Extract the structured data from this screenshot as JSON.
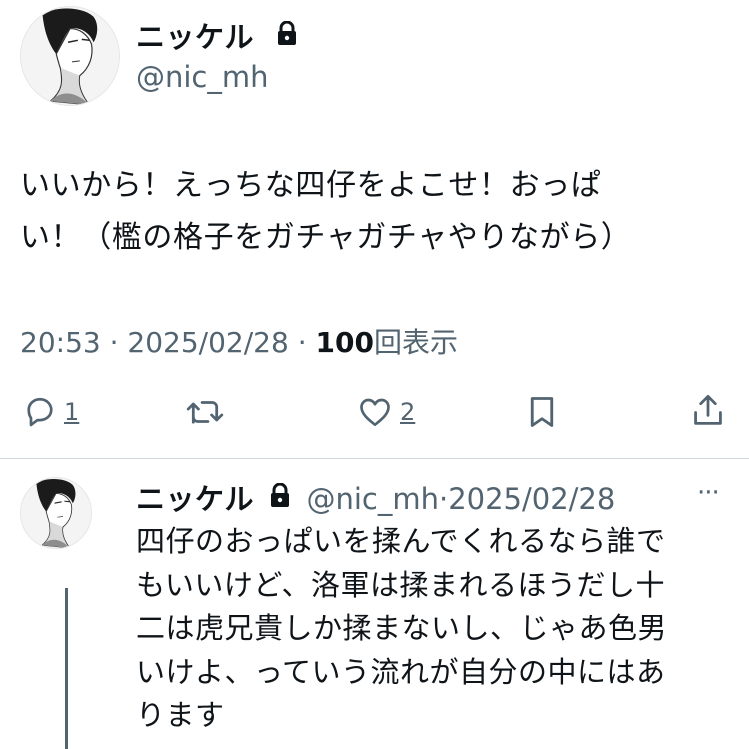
{
  "tweet": {
    "author_name": "ニッケル",
    "author_handle": "@nic_mh",
    "lines": [
      "いいから！えっちな四仔をよこせ！おっぱ",
      "い！（檻の格子をガチャガチャやりながら）"
    ],
    "time": "20:53",
    "date": "2025/02/28",
    "separator": "·",
    "view_count": "100",
    "view_label": "回表示",
    "reply_count": "1",
    "like_count": "2",
    "icons": [
      "lock-icon",
      "reply-icon",
      "retweet-icon",
      "like-icon",
      "bookmark-icon",
      "share-icon"
    ]
  },
  "reply": {
    "author_name": "ニッケル",
    "author_handle": "@nic_mh",
    "separator": "·",
    "date": "2025/02/28",
    "more": "···",
    "lines": [
      "四仔のおっぱいを揉んでくれるなら誰で",
      "もいいけど、洛軍は揉まれるほうだし十",
      "二は虎兄貴しか揉まないし、じゃあ色男",
      "いけよ、っていう流れが自分の中にはあ",
      "ります"
    ]
  },
  "colors": {
    "text": "#0f1419",
    "secondary": "#536471",
    "divider": "#cfd9de"
  }
}
